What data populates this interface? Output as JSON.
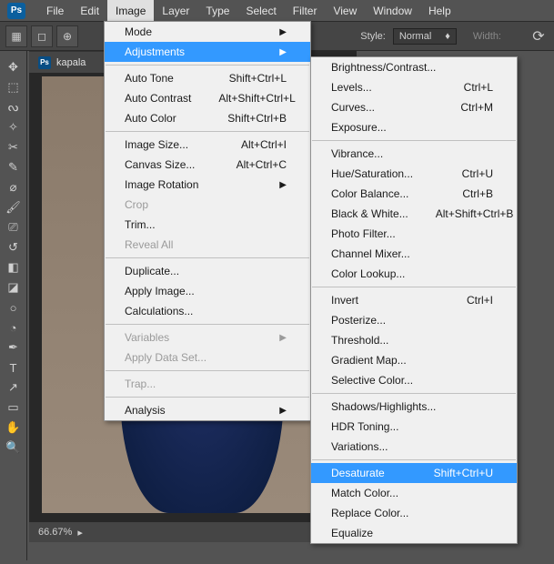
{
  "menubar": {
    "items": [
      "File",
      "Edit",
      "Image",
      "Layer",
      "Type",
      "Select",
      "Filter",
      "View",
      "Window",
      "Help"
    ],
    "open_index": 2
  },
  "toolbar": {
    "style_label": "Style:",
    "style_value": "Normal",
    "width_label": "Width:"
  },
  "tab": {
    "name": "kapala"
  },
  "statusbar": {
    "zoom": "66.67%"
  },
  "image_menu": {
    "items": [
      {
        "label": "Mode",
        "sub": true
      },
      {
        "label": "Adjustments",
        "sub": true,
        "highlight": true
      },
      {
        "sep": true
      },
      {
        "label": "Auto Tone",
        "shortcut": "Shift+Ctrl+L"
      },
      {
        "label": "Auto Contrast",
        "shortcut": "Alt+Shift+Ctrl+L"
      },
      {
        "label": "Auto Color",
        "shortcut": "Shift+Ctrl+B"
      },
      {
        "sep": true
      },
      {
        "label": "Image Size...",
        "shortcut": "Alt+Ctrl+I"
      },
      {
        "label": "Canvas Size...",
        "shortcut": "Alt+Ctrl+C"
      },
      {
        "label": "Image Rotation",
        "sub": true
      },
      {
        "label": "Crop",
        "disabled": true
      },
      {
        "label": "Trim..."
      },
      {
        "label": "Reveal All",
        "disabled": true
      },
      {
        "sep": true
      },
      {
        "label": "Duplicate..."
      },
      {
        "label": "Apply Image..."
      },
      {
        "label": "Calculations..."
      },
      {
        "sep": true
      },
      {
        "label": "Variables",
        "sub": true,
        "disabled": true
      },
      {
        "label": "Apply Data Set...",
        "disabled": true
      },
      {
        "sep": true
      },
      {
        "label": "Trap...",
        "disabled": true
      },
      {
        "sep": true
      },
      {
        "label": "Analysis",
        "sub": true
      }
    ]
  },
  "adjustments_menu": {
    "items": [
      {
        "label": "Brightness/Contrast..."
      },
      {
        "label": "Levels...",
        "shortcut": "Ctrl+L"
      },
      {
        "label": "Curves...",
        "shortcut": "Ctrl+M"
      },
      {
        "label": "Exposure..."
      },
      {
        "sep": true
      },
      {
        "label": "Vibrance..."
      },
      {
        "label": "Hue/Saturation...",
        "shortcut": "Ctrl+U"
      },
      {
        "label": "Color Balance...",
        "shortcut": "Ctrl+B"
      },
      {
        "label": "Black & White...",
        "shortcut": "Alt+Shift+Ctrl+B"
      },
      {
        "label": "Photo Filter..."
      },
      {
        "label": "Channel Mixer..."
      },
      {
        "label": "Color Lookup..."
      },
      {
        "sep": true
      },
      {
        "label": "Invert",
        "shortcut": "Ctrl+I"
      },
      {
        "label": "Posterize..."
      },
      {
        "label": "Threshold..."
      },
      {
        "label": "Gradient Map..."
      },
      {
        "label": "Selective Color..."
      },
      {
        "sep": true
      },
      {
        "label": "Shadows/Highlights..."
      },
      {
        "label": "HDR Toning..."
      },
      {
        "label": "Variations..."
      },
      {
        "sep": true
      },
      {
        "label": "Desaturate",
        "shortcut": "Shift+Ctrl+U",
        "highlight": true
      },
      {
        "label": "Match Color..."
      },
      {
        "label": "Replace Color..."
      },
      {
        "label": "Equalize"
      }
    ]
  }
}
